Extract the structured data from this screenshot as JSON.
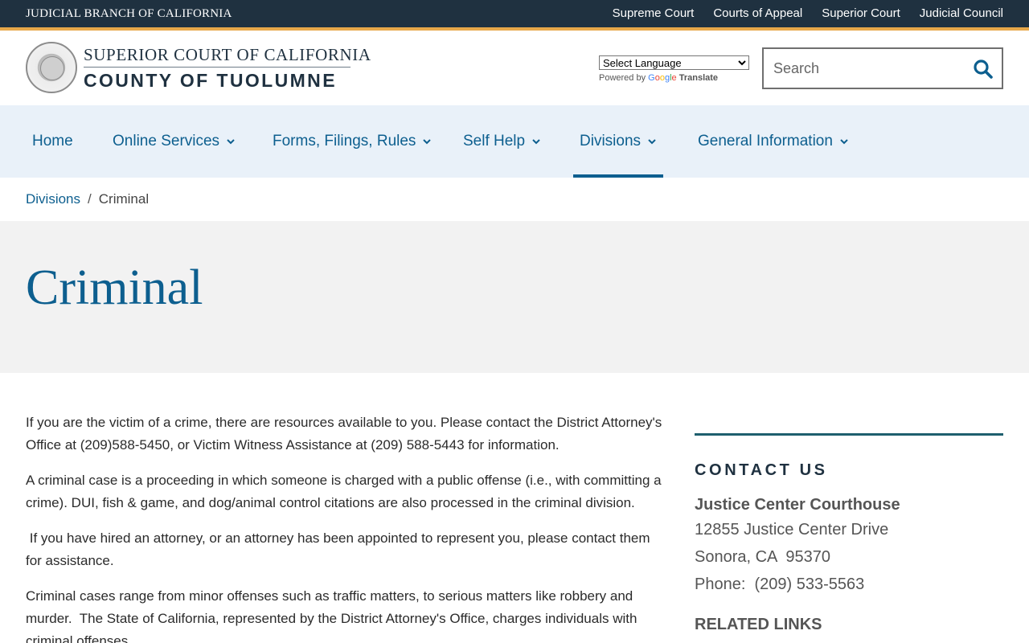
{
  "topbar": {
    "brand": "JUDICIAL BRANCH OF CALIFORNIA",
    "links": [
      "Supreme Court",
      "Courts of Appeal",
      "Superior Court",
      "Judicial Council"
    ]
  },
  "header": {
    "logo_line1": "SUPERIOR COURT OF CALIFORNIA",
    "logo_line2": "COUNTY OF TUOLUMNE",
    "language_select": "Select Language",
    "powered_by": "Powered by",
    "google": "Google",
    "translate": "Translate",
    "search_placeholder": "Search"
  },
  "nav": {
    "items": [
      {
        "label": "Home"
      },
      {
        "label": "Online Services"
      },
      {
        "label": "Forms, Filings, Rules"
      },
      {
        "label": "Self Help"
      },
      {
        "label": "Divisions"
      },
      {
        "label": "General Information"
      }
    ]
  },
  "breadcrumb": {
    "parent": "Divisions",
    "separator": "/",
    "current": "Criminal"
  },
  "page_title": "Criminal",
  "content": {
    "paragraphs": [
      "If you are the victim of a crime, there are resources available to you. Please contact the District Attorney's Office at (209)588-5450, or Victim Witness Assistance at (209) 588-5443 for information.",
      "A criminal case is a proceeding in which someone is charged with a public offense (i.e., with committing a crime). DUI, fish & game, and dog/animal control citations are also processed in the criminal division.",
      " If you have hired an attorney, or an attorney has been appointed to represent you, please contact them for assistance.",
      "Criminal cases range from minor offenses such as traffic matters, to serious matters like robbery and murder.  The State of California, represented by the District Attorney's Office, charges individuals with criminal offenses."
    ]
  },
  "sidebar": {
    "contact_title": "CONTACT US",
    "court_name": "Justice Center Courthouse",
    "address_line1": "12855 Justice Center Drive",
    "address_line2": "Sonora, CA  95370",
    "phone": "Phone:  (209) 533-5563",
    "related_title": "RELATED LINKS"
  },
  "colors": {
    "topbar": "#1f3140",
    "accent": "#e7a84a",
    "link": "#0d5f8f",
    "nav_bg": "#e9f1f9",
    "hero_bg": "#f2f2f2"
  }
}
